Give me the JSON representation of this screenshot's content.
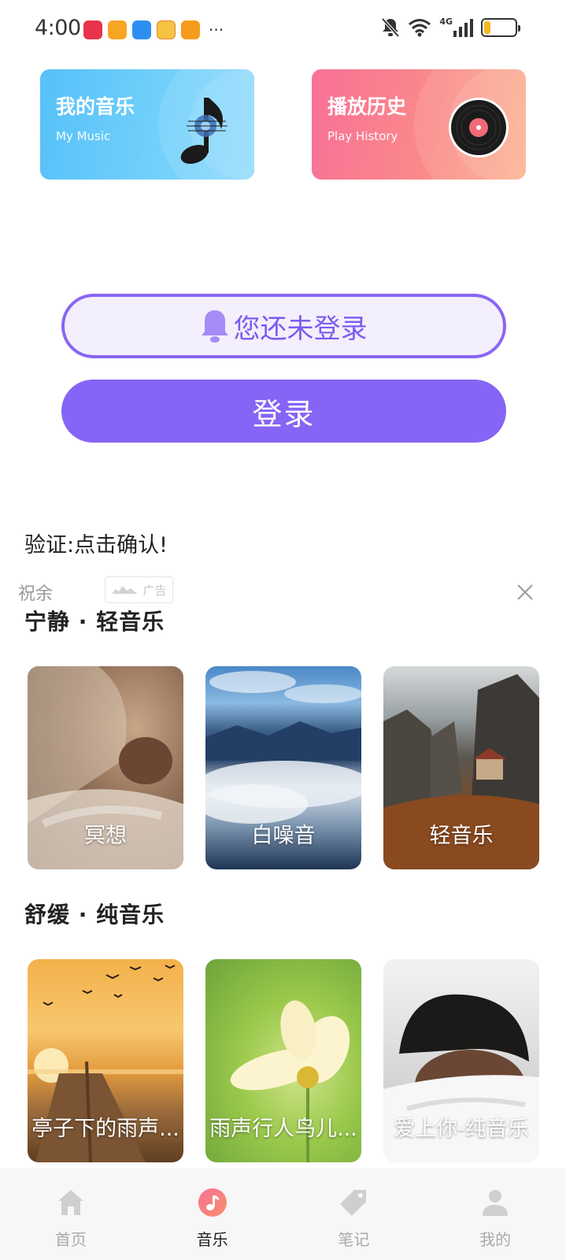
{
  "status_bar": {
    "time": "4:00",
    "network": "4G",
    "battery_level": 0.2,
    "app_icons": [
      "red-app-icon",
      "yellow-app-icon",
      "blue-app-icon",
      "weibo-icon",
      "video-app-icon"
    ],
    "more": "···"
  },
  "cards": {
    "my_music": {
      "title": "我的音乐",
      "subtitle": "My Music",
      "icon": "music-note-icon"
    },
    "play_history": {
      "title": "播放历史",
      "subtitle": "Play History",
      "icon": "vinyl-record-icon"
    }
  },
  "login": {
    "notice": "您还未登录",
    "button": "登录"
  },
  "verify_text": "验证:点击确认!",
  "ad": {
    "name": "祝余",
    "badge": "广告"
  },
  "sections": [
    {
      "title": "宁静 · 轻音乐",
      "items": [
        {
          "label": "冥想"
        },
        {
          "label": "白噪音"
        },
        {
          "label": "轻音乐"
        }
      ]
    },
    {
      "title": "舒缓 · 纯音乐",
      "items": [
        {
          "label": "亭子下的雨声..."
        },
        {
          "label": "雨声行人鸟儿..."
        },
        {
          "label": "爱上你-纯音乐"
        }
      ]
    }
  ],
  "bottom_nav": [
    {
      "label": "首页",
      "icon": "home-icon",
      "active": false
    },
    {
      "label": "音乐",
      "icon": "music-icon",
      "active": true
    },
    {
      "label": "笔记",
      "icon": "tag-icon",
      "active": false
    },
    {
      "label": "我的",
      "icon": "profile-icon",
      "active": false
    }
  ],
  "colors": {
    "accent": "#8664f5",
    "nav_active": "#f26a6a"
  }
}
